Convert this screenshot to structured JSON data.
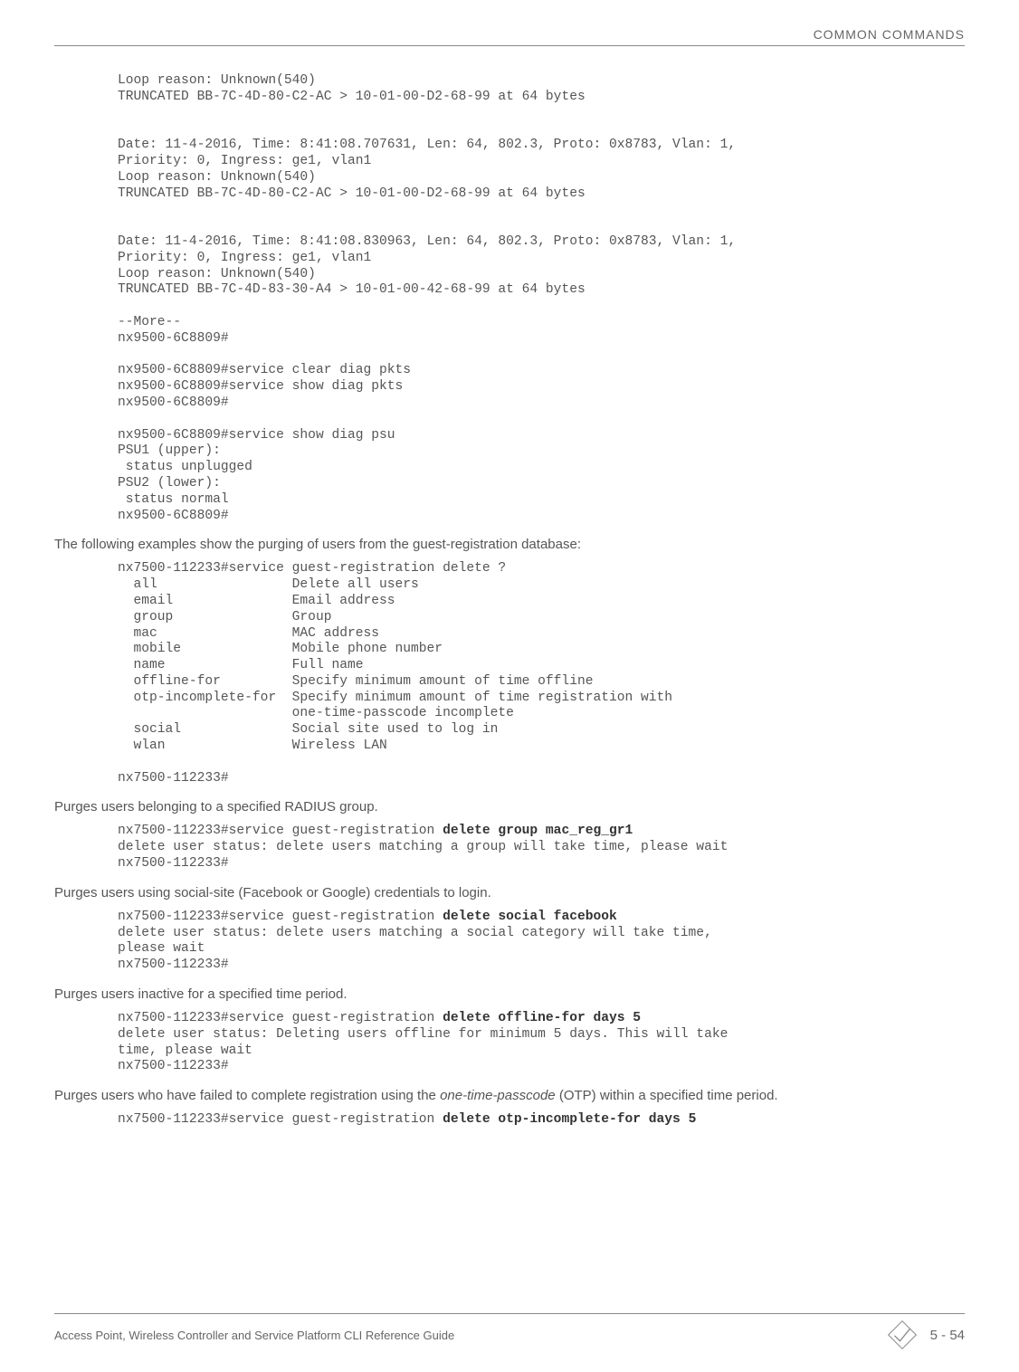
{
  "header": {
    "title": "COMMON COMMANDS"
  },
  "code1": "Loop reason: Unknown(540)\nTRUNCATED BB-7C-4D-80-C2-AC > 10-01-00-D2-68-99 at 64 bytes\n\n\nDate: 11-4-2016, Time: 8:41:08.707631, Len: 64, 802.3, Proto: 0x8783, Vlan: 1,\nPriority: 0, Ingress: ge1, vlan1\nLoop reason: Unknown(540)\nTRUNCATED BB-7C-4D-80-C2-AC > 10-01-00-D2-68-99 at 64 bytes\n\n\nDate: 11-4-2016, Time: 8:41:08.830963, Len: 64, 802.3, Proto: 0x8783, Vlan: 1,\nPriority: 0, Ingress: ge1, vlan1\nLoop reason: Unknown(540)\nTRUNCATED BB-7C-4D-83-30-A4 > 10-01-00-42-68-99 at 64 bytes\n\n--More--\nnx9500-6C8809#\n\nnx9500-6C8809#service clear diag pkts\nnx9500-6C8809#service show diag pkts\nnx9500-6C8809#\n\nnx9500-6C8809#service show diag psu\nPSU1 (upper):\n status unplugged\nPSU2 (lower):\n status normal\nnx9500-6C8809#",
  "para1": "The following examples show the purging of users from the guest-registration database:",
  "code2": "nx7500-112233#service guest-registration delete ?\n  all                 Delete all users\n  email               Email address\n  group               Group\n  mac                 MAC address\n  mobile              Mobile phone number\n  name                Full name\n  offline-for         Specify minimum amount of time offline\n  otp-incomplete-for  Specify minimum amount of time registration with\n                      one-time-passcode incomplete\n  social              Social site used to log in\n  wlan                Wireless LAN\n\nnx7500-112233#",
  "para2": "Purges users belonging to a specified RADIUS group.",
  "code3a": "nx7500-112233#service guest-registration ",
  "code3b": "delete group mac_reg_gr1",
  "code3c": "\ndelete user status: delete users matching a group will take time, please wait\nnx7500-112233#",
  "para3": "Purges users using social-site (Facebook or Google) credentials to login.",
  "code4a": "nx7500-112233#service guest-registration ",
  "code4b": "delete social facebook",
  "code4c": "\ndelete user status: delete users matching a social category will take time,\nplease wait\nnx7500-112233#",
  "para4": "Purges users inactive for a specified time period.",
  "code5a": "nx7500-112233#service guest-registration ",
  "code5b": "delete offline-for days 5",
  "code5c": "\ndelete user status: Deleting users offline for minimum 5 days. This will take\ntime, please wait\nnx7500-112233#",
  "para5a": "Purges users who have failed to complete registration using the ",
  "para5b": "one-time-passcode",
  "para5c": " (OTP) within a specified time period.",
  "code6a": "nx7500-112233#service guest-registration ",
  "code6b": "delete otp-incomplete-for days 5",
  "footer": {
    "left": "Access Point, Wireless Controller and Service Platform CLI Reference Guide",
    "page": "5 - 54"
  }
}
